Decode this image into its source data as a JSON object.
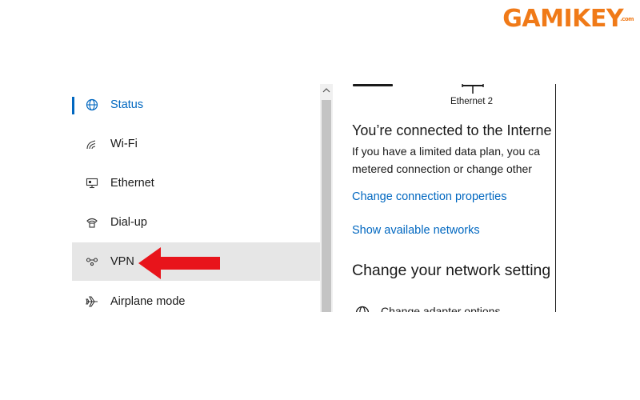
{
  "watermark": {
    "logo_text": "GAMIKEY",
    "logo_suffix": ".com",
    "color": "#f07a18"
  },
  "accent_color": "#0067c0",
  "annotation_arrow_color": "#e8141b",
  "sidebar": {
    "items": [
      {
        "label": "Status",
        "icon": "globe-icon",
        "active": true
      },
      {
        "label": "Wi-Fi",
        "icon": "wifi-icon"
      },
      {
        "label": "Ethernet",
        "icon": "ethernet-icon"
      },
      {
        "label": "Dial-up",
        "icon": "phone-icon"
      },
      {
        "label": "VPN",
        "icon": "vpn-icon",
        "highlighted": true
      },
      {
        "label": "Airplane mode",
        "icon": "airplane-icon"
      }
    ]
  },
  "content": {
    "ethernet_label": "Ethernet 2",
    "connected_title": "You’re connected to the Interne",
    "description_line1": "If you have a limited data plan, you ca",
    "description_line2": "metered connection or change other",
    "change_connection_link": "Change connection properties",
    "show_networks_link": "Show available networks",
    "change_settings_heading": "Change your network setting",
    "change_adapter_text": "Change adapter options"
  }
}
